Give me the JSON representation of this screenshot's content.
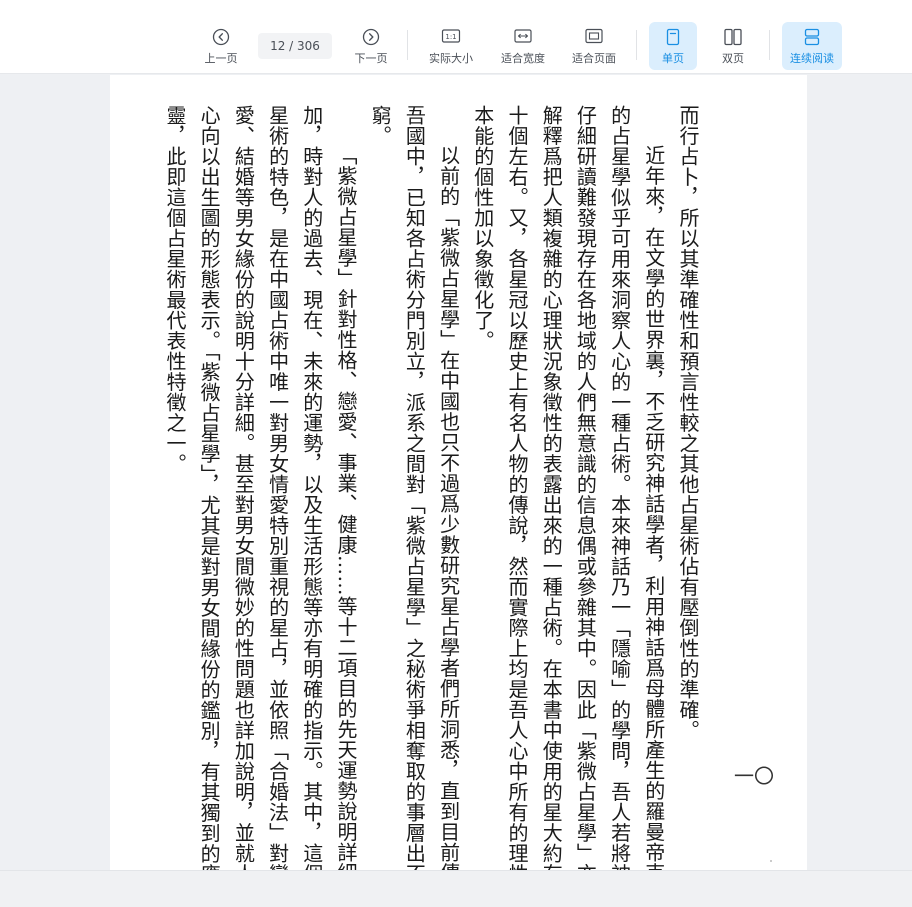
{
  "toolbar": {
    "prev_label": "上一页",
    "current_page": "12",
    "page_separator": " / ",
    "total_pages": "306",
    "next_label": "下一页",
    "actual_size_label": "实际大小",
    "fit_width_label": "适合宽度",
    "fit_page_label": "适合页面",
    "single_page_label": "单页",
    "double_page_label": "双页",
    "continuous_label": "连续阅读",
    "actual_size_icon_text": "1:1",
    "accent_color": "#1a8fe3"
  },
  "document": {
    "paragraphs": [
      "而行占卜，所以其準確性和預言性較之其他占星術佔有壓倒性的準確。",
      "近年來，在文學的世界裏，不乏研究神話學者，利用神話爲母體所產生的羅曼帝克式的占星學似乎可用來洞察人心的一種占術。本來神話乃一「隱喻」的學問，吾人若將神話仔細研讀難發現存在各地域的人們無意識的信息偶或參雜其中。因此「紫微占星學」亦可解釋爲把人類複雜的心理狀況象徵性的表露出來的一種占術。在本書中使用的星大約有二十個左右。又，各星冠以歷史上有名人物的傳說，然而實際上均是吾人心中所有的理性和本能的個性加以象徵化了。",
      "以前的「紫微占星學」在中國也只不過爲少數研究星占學者們所洞悉，直到目前傳至吾國中，已知各占術分門別立，派系之間對「紫微占星學」之秘術爭相奪取的事層出不窮。",
      "「紫微占星學」針對性格、戀愛、事業、健康……等十二項目的先天運勢說明詳細有加，時對人的過去、現在、未來的運勢，以及生活形態等亦有明確的指示。其中，這個占星術的特色，是在中國占術中唯一對男女情愛特別重視的星占，並依照「合婚法」對戀愛、結婚等男女緣份的說明十分詳細。甚至對男女間微妙的性問題也詳加說明，並就人的心向以出生圖的形態表示。「紫微占星學」，尤其是對男女間緣份的鑑別，有其獨到的應靈，此即這個占星術最代表性特徵之一。"
    ],
    "page_number": "一〇"
  }
}
